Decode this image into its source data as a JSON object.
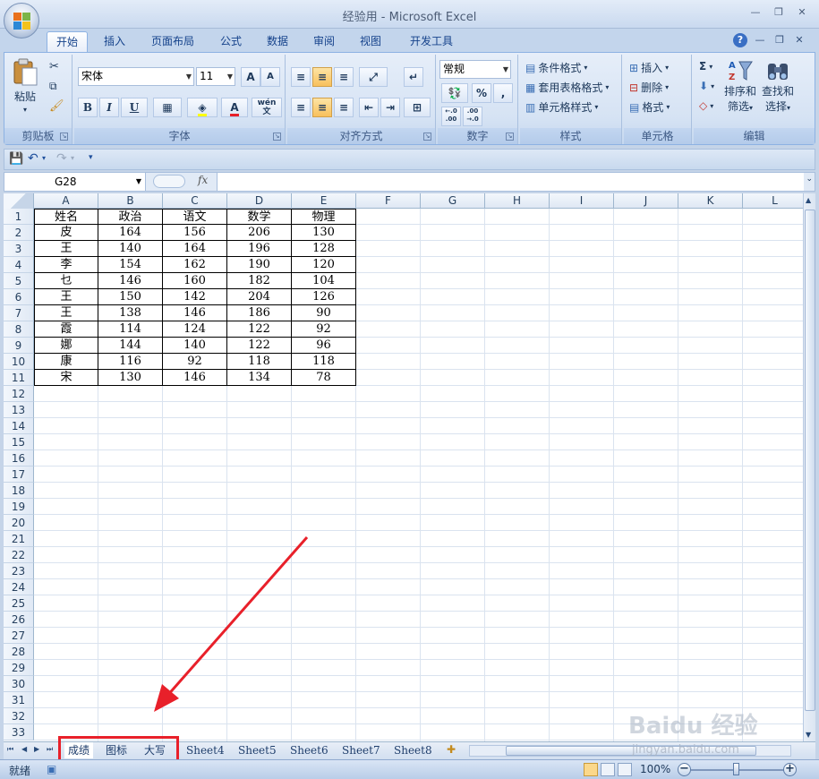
{
  "window": {
    "title": "经验用 - Microsoft Excel"
  },
  "tabs": [
    "开始",
    "插入",
    "页面布局",
    "公式",
    "数据",
    "审阅",
    "视图",
    "开发工具"
  ],
  "ribbon": {
    "clipboard": {
      "paste": "粘贴",
      "label": "剪贴板"
    },
    "font": {
      "name": "宋体",
      "size": "11",
      "label": "字体",
      "bold": "B",
      "italic": "I",
      "underline": "U",
      "grow": "A",
      "shrink": "A",
      "fontcolor": "A",
      "phonetic": "wén"
    },
    "alignment": {
      "label": "对齐方式"
    },
    "number": {
      "format": "常规",
      "percent": "%",
      "comma": ",",
      "label": "数字",
      "inc_decimal": "←.0 .00",
      "dec_decimal": ".00 →.0"
    },
    "styles": {
      "conditional": "条件格式",
      "table": "套用表格格式",
      "cell": "单元格样式",
      "label": "样式"
    },
    "cells": {
      "insert": "插入",
      "delete": "删除",
      "format": "格式",
      "label": "单元格"
    },
    "editing": {
      "sigma": "Σ",
      "sort": "排序和",
      "sort2": "筛选",
      "find": "查找和",
      "find2": "选择",
      "label": "编辑"
    }
  },
  "formula_bar": {
    "name_box": "G28",
    "fx": "fx",
    "formula": ""
  },
  "columns": [
    "A",
    "B",
    "C",
    "D",
    "E",
    "F",
    "G",
    "H",
    "I",
    "J",
    "K",
    "L"
  ],
  "row_count": 33,
  "table": {
    "headers": [
      "姓名",
      "政治",
      "语文",
      "数学",
      "物理"
    ],
    "rows": [
      [
        "皮",
        "164",
        "156",
        "206",
        "130"
      ],
      [
        "王",
        "140",
        "164",
        "196",
        "128"
      ],
      [
        "李",
        "154",
        "162",
        "190",
        "120"
      ],
      [
        "乜",
        "146",
        "160",
        "182",
        "104"
      ],
      [
        "王",
        "150",
        "142",
        "204",
        "126"
      ],
      [
        "王",
        "138",
        "146",
        "186",
        "90"
      ],
      [
        "霞",
        "114",
        "124",
        "122",
        "92"
      ],
      [
        "娜",
        "144",
        "140",
        "122",
        "96"
      ],
      [
        "康",
        "116",
        "92",
        "118",
        "118"
      ],
      [
        "宋",
        "130",
        "146",
        "134",
        "78"
      ]
    ]
  },
  "sheets": [
    "成绩",
    "图标",
    "大写",
    "Sheet4",
    "Sheet5",
    "Sheet6",
    "Sheet7",
    "Sheet8"
  ],
  "active_sheet": "成绩",
  "status": {
    "text": "就绪",
    "zoom": "100%"
  },
  "watermark": {
    "brand": "Baidu 经验",
    "url": "jingyan.baidu.com"
  },
  "colors": {
    "highlight": "#e8202a",
    "ribbon": "#d6e3f4",
    "active_tab_bg": "#ffffff"
  }
}
